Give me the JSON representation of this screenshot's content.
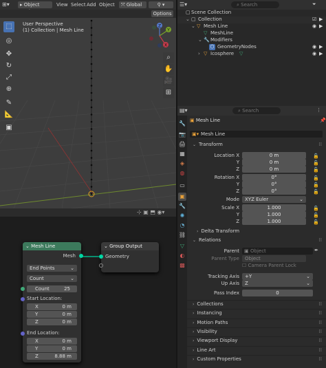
{
  "header": {
    "mode": "Object Mode",
    "menus": [
      "View",
      "Select",
      "Add",
      "Object"
    ],
    "orientation": "Global",
    "options": "Options"
  },
  "viewport": {
    "persp": "User Perspective",
    "collection": "(1) Collection | Mesh Line",
    "axes": {
      "z": "Z",
      "y": "Y",
      "x": "X"
    }
  },
  "outliner": {
    "search_placeholder": "Search",
    "items": [
      {
        "label": "Scene Collection"
      },
      {
        "label": "Collection"
      },
      {
        "label": "Mesh Line"
      },
      {
        "label": "MeshLine"
      },
      {
        "label": "Modifiers"
      },
      {
        "label": "GeometryNodes"
      },
      {
        "label": "Icosphere"
      }
    ]
  },
  "props": {
    "search_placeholder": "Search",
    "object_name": "Mesh Line",
    "object_field": "Mesh Line",
    "transform": {
      "title": "Transform",
      "loc_x_label": "Location X",
      "loc_y_label": "Y",
      "loc_z_label": "Z",
      "loc_x": "0 m",
      "loc_y": "0 m",
      "loc_z": "0 m",
      "rot_x_label": "Rotation X",
      "rot_y_label": "Y",
      "rot_z_label": "Z",
      "rot_x": "0°",
      "rot_y": "0°",
      "rot_z": "0°",
      "mode_label": "Mode",
      "mode": "XYZ Euler",
      "scale_x_label": "Scale X",
      "scale_y_label": "Y",
      "scale_z_label": "Z",
      "scale_x": "1.000",
      "scale_y": "1.000",
      "scale_z": "1.000",
      "delta": "Delta Transform"
    },
    "relations": {
      "title": "Relations",
      "parent_label": "Parent",
      "parent_placeholder": "Object",
      "parent_type_label": "Parent Type",
      "parent_type": "Object",
      "camera_lock": "Camera Parent Lock",
      "tracking_label": "Tracking Axis",
      "tracking": "+Y",
      "up_label": "Up Axis",
      "up": "Z",
      "pass_label": "Pass Index",
      "pass": "0"
    },
    "sections": [
      "Collections",
      "Instancing",
      "Motion Paths",
      "Visibility",
      "Viewport Display",
      "Line Art",
      "Custom Properties"
    ]
  },
  "nodes": {
    "meshline": {
      "title": "Mesh Line",
      "output": "Mesh",
      "mode": "End Points",
      "count_mode": "Count",
      "count_label": "Count",
      "count": "25",
      "start_label": "Start Location:",
      "sx_l": "X",
      "sy_l": "Y",
      "sz_l": "Z",
      "sx": "0 m",
      "sy": "0 m",
      "sz": "0 m",
      "end_label": "End Location:",
      "ex_l": "X",
      "ey_l": "Y",
      "ez_l": "Z",
      "ex": "0 m",
      "ey": "0 m",
      "ez": "8.88 m"
    },
    "output": {
      "title": "Group Output",
      "input": "Geometry"
    }
  },
  "colors": {
    "accent": "#4772b3",
    "node_header_green": "#3c7a5c",
    "socket_green": "#00d6a3",
    "socket_purple": "#6363c7",
    "socket_gray": "#a1a1a1"
  }
}
